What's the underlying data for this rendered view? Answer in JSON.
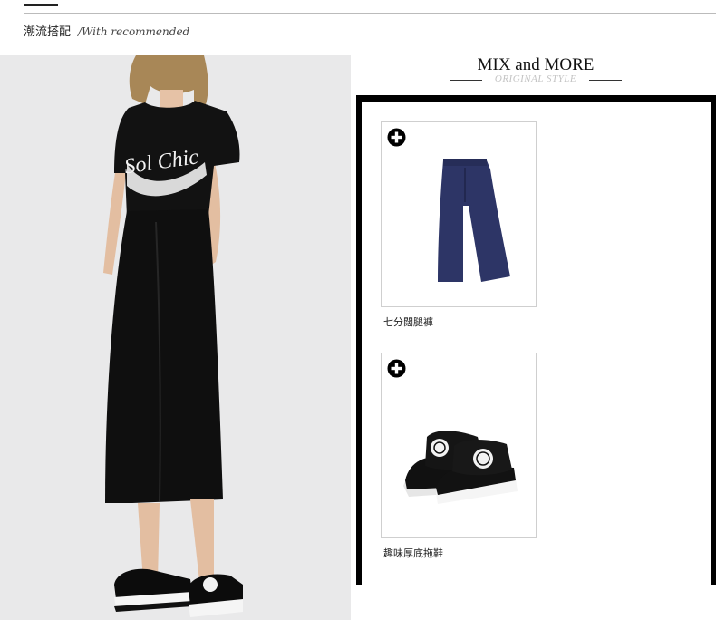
{
  "section": {
    "title": "潮流搭配",
    "subtitle": "/With recommended"
  },
  "mix": {
    "title": "MIX and MORE",
    "subtitle": "ORIGINAL STYLE"
  },
  "products": [
    {
      "name": "七分闊腿褲",
      "icon": "plus-circle-icon"
    },
    {
      "name": "趣味厚底拖鞋",
      "icon": "plus-circle-icon"
    }
  ],
  "colors": {
    "frame": "#000000",
    "pants": "#2d3566",
    "photo_bg": "#e9e9ea"
  }
}
